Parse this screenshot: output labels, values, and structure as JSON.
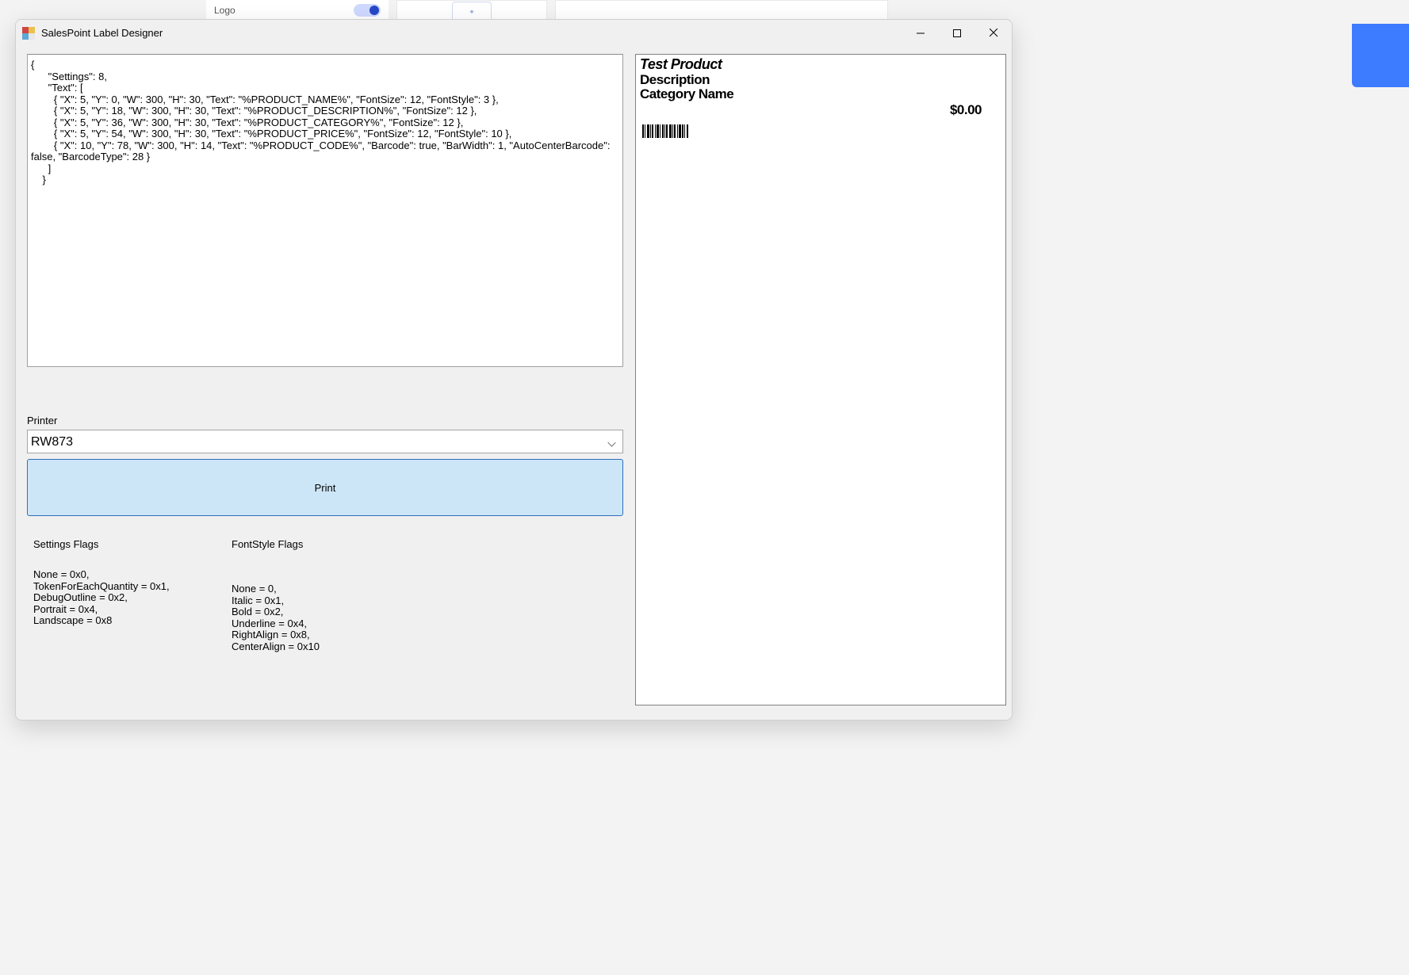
{
  "background": {
    "logo_label": "Logo"
  },
  "window": {
    "title": "SalesPoint Label Designer"
  },
  "editor": {
    "code_text": "{\n      \"Settings\": 8,\n      \"Text\": [\n        { \"X\": 5, \"Y\": 0, \"W\": 300, \"H\": 30, \"Text\": \"%PRODUCT_NAME%\", \"FontSize\": 12, \"FontStyle\": 3 },\n        { \"X\": 5, \"Y\": 18, \"W\": 300, \"H\": 30, \"Text\": \"%PRODUCT_DESCRIPTION%\", \"FontSize\": 12 },\n        { \"X\": 5, \"Y\": 36, \"W\": 300, \"H\": 30, \"Text\": \"%PRODUCT_CATEGORY%\", \"FontSize\": 12 },\n        { \"X\": 5, \"Y\": 54, \"W\": 300, \"H\": 30, \"Text\": \"%PRODUCT_PRICE%\", \"FontSize\": 12, \"FontStyle\": 10 },\n        { \"X\": 10, \"Y\": 78, \"W\": 300, \"H\": 14, \"Text\": \"%PRODUCT_CODE%\", \"Barcode\": true, \"BarWidth\": 1, \"AutoCenterBarcode\": false, \"BarcodeType\": 28 }\n      ]\n    }"
  },
  "printer": {
    "label": "Printer",
    "selected": "RW873"
  },
  "buttons": {
    "print": "Print"
  },
  "flags": {
    "settings_header": "Settings Flags",
    "settings_body": "None = 0x0,\nTokenForEachQuantity = 0x1,\nDebugOutline = 0x2,\nPortrait = 0x4,\nLandscape = 0x8",
    "fontstyle_header": "FontStyle Flags",
    "fontstyle_body": "None = 0,\nItalic = 0x1,\nBold = 0x2,\nUnderline = 0x4,\nRightAlign = 0x8,\nCenterAlign = 0x10"
  },
  "preview": {
    "product_name": "Test Product",
    "description": "Description",
    "category": "Category Name",
    "price": "$0.00"
  }
}
